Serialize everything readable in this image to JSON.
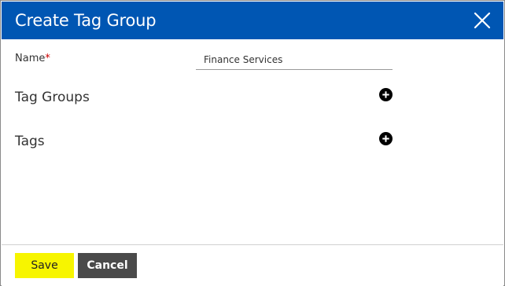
{
  "dialog": {
    "title": "Create Tag Group",
    "close_icon": "close-icon"
  },
  "form": {
    "name_label": "Name",
    "required_marker": "*",
    "name_value": "Finance Services"
  },
  "sections": {
    "tag_groups_label": "Tag Groups",
    "tags_label": "Tags",
    "add_icon": "plus-circle-icon"
  },
  "footer": {
    "save_label": "Save",
    "cancel_label": "Cancel"
  },
  "colors": {
    "header_bg": "#0056b3",
    "save_bg": "#f7f500",
    "cancel_bg": "#4a4a4a",
    "required": "#cc0000"
  }
}
